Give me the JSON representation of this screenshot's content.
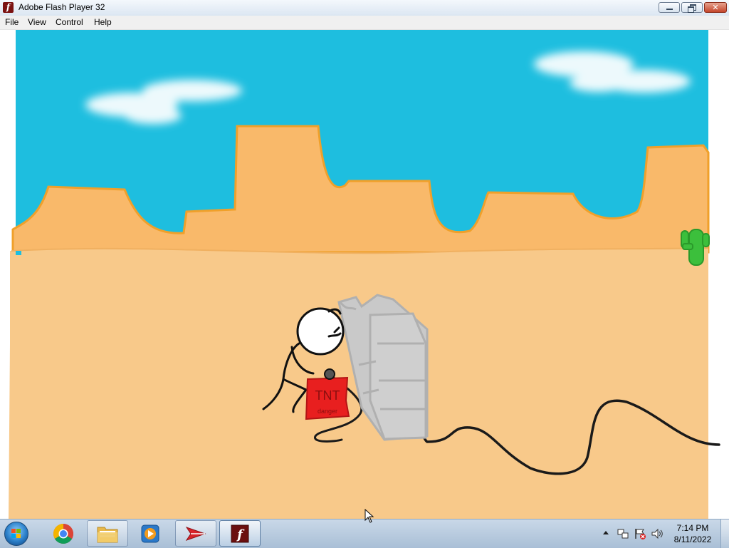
{
  "window": {
    "title": "Adobe Flash Player 32",
    "icon": "flash-player-icon",
    "controls": {
      "minimize": "minimize-icon",
      "maximize": "restore-icon",
      "close_label": "✕"
    }
  },
  "menu": {
    "items": [
      {
        "label": "File"
      },
      {
        "label": "View"
      },
      {
        "label": "Control"
      },
      {
        "label": "Help"
      }
    ]
  },
  "stage": {
    "scene": "desert-with-stick-figure-tnt",
    "tnt_label": "TNT",
    "tnt_sublabel": "danger",
    "colors": {
      "sky": "#1ebedf",
      "mesa": "#f9b96a",
      "mesa_outline": "#f0a02a",
      "sand": "#f8c98a",
      "tnt": "#e81f1f",
      "wall": "#c9c9c9",
      "cactus": "#3cbf3c"
    }
  },
  "taskbar": {
    "pinned": [
      {
        "name": "chrome",
        "icon": "chrome-icon"
      },
      {
        "name": "file-explorer",
        "icon": "folder-icon"
      },
      {
        "name": "media-player",
        "icon": "media-player-icon"
      },
      {
        "name": "arrow-app",
        "icon": "paper-plane-icon"
      },
      {
        "name": "flash-player",
        "icon": "flash-player-icon"
      }
    ],
    "clock": {
      "time": "7:14 PM",
      "date": "8/11/2022"
    }
  }
}
